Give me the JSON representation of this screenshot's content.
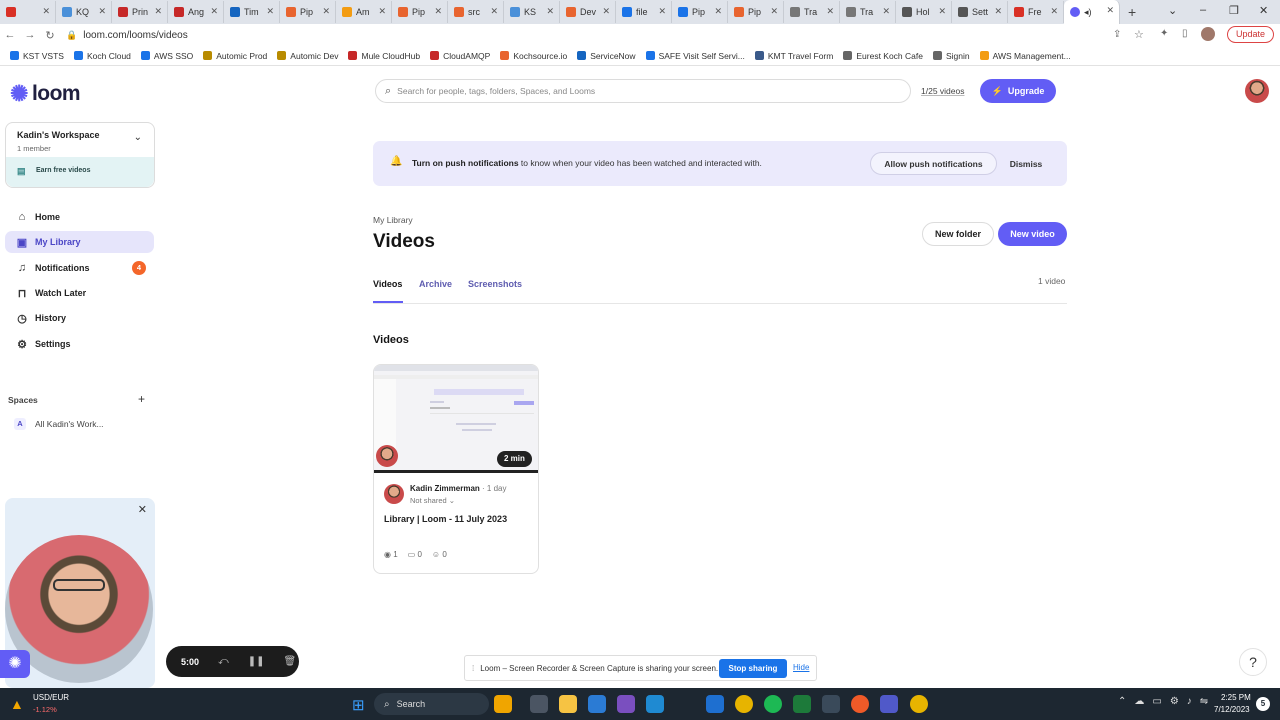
{
  "browser": {
    "tabs": [
      {
        "label": "",
        "color": "#d93025"
      },
      {
        "label": "KQ",
        "color": "#4a90d9"
      },
      {
        "label": "Prin",
        "color": "#c62828"
      },
      {
        "label": "Ang",
        "color": "#c62828"
      },
      {
        "label": "Tim",
        "color": "#1565c0"
      },
      {
        "label": "Pip",
        "color": "#e8642f"
      },
      {
        "label": "Am",
        "color": "#f39c12"
      },
      {
        "label": "Pip",
        "color": "#e8642f"
      },
      {
        "label": "src",
        "color": "#e8642f"
      },
      {
        "label": "KS",
        "color": "#4a90d9"
      },
      {
        "label": "Dev",
        "color": "#e8642f"
      },
      {
        "label": "file",
        "color": "#1a73e8"
      },
      {
        "label": "Pip",
        "color": "#1a73e8"
      },
      {
        "label": "Pip",
        "color": "#e8642f"
      },
      {
        "label": "Tra",
        "color": "#777777"
      },
      {
        "label": "Tra",
        "color": "#777777"
      },
      {
        "label": "Hol",
        "color": "#555555"
      },
      {
        "label": "Sett",
        "color": "#555555"
      },
      {
        "label": "Fre",
        "color": "#d93025"
      }
    ],
    "url": "loom.com/looms/videos",
    "update_label": "Update",
    "bookmarks": [
      {
        "label": "KST VSTS",
        "color": "#1a73e8"
      },
      {
        "label": "Koch Cloud",
        "color": "#1a73e8"
      },
      {
        "label": "AWS SSO",
        "color": "#1a73e8"
      },
      {
        "label": "Automic Prod",
        "color": "#b88b00"
      },
      {
        "label": "Automic Dev",
        "color": "#b88b00"
      },
      {
        "label": "Mule CloudHub",
        "color": "#c62828"
      },
      {
        "label": "CloudAMQP",
        "color": "#c62828"
      },
      {
        "label": "Kochsource.io",
        "color": "#e8642f"
      },
      {
        "label": "ServiceNow",
        "color": "#1565c0"
      },
      {
        "label": "SAFE Visit Self Servi...",
        "color": "#1a73e8"
      },
      {
        "label": "KMT Travel Form",
        "color": "#3a5a8a"
      },
      {
        "label": "Eurest Koch Cafe",
        "color": "#666666"
      },
      {
        "label": "Signin",
        "color": "#666666"
      },
      {
        "label": "AWS Management...",
        "color": "#f39c12"
      }
    ]
  },
  "sidebar": {
    "logo": "loom",
    "workspace": {
      "name": "Kadin's Workspace",
      "members": "1 member",
      "earn": "Earn free videos"
    },
    "nav": [
      {
        "label": "Home",
        "icon": "home-icon"
      },
      {
        "label": "My Library",
        "icon": "library-icon"
      },
      {
        "label": "Notifications",
        "icon": "bell-icon",
        "badge": "4"
      },
      {
        "label": "Watch Later",
        "icon": "bookmark-icon"
      },
      {
        "label": "History",
        "icon": "history-icon"
      },
      {
        "label": "Settings",
        "icon": "gear-icon"
      }
    ],
    "spaces_label": "Spaces",
    "spaces": [
      {
        "initial": "A",
        "label": "All Kadin's Work..."
      }
    ]
  },
  "recorder": {
    "time": "5:00"
  },
  "header": {
    "search_placeholder": "Search for people, tags, folders, Spaces, and Looms",
    "video_quota": "1/25 videos",
    "upgrade": "Upgrade"
  },
  "push_banner": {
    "bold": "Turn on push notifications",
    "text": " to know when your video has been watched and interacted with.",
    "allow": "Allow push notifications",
    "dismiss": "Dismiss"
  },
  "library": {
    "breadcrumb": "My Library",
    "title": "Videos",
    "new_folder": "New folder",
    "new_video": "New video",
    "tabs": [
      "Videos",
      "Archive",
      "Screenshots"
    ],
    "count": "1 video",
    "section": "Videos"
  },
  "video": {
    "duration": "2 min",
    "author": "Kadin Zimmerman",
    "age": "· 1 day",
    "sharing": "Not shared",
    "title": "Library | Loom - 11 July 2023",
    "views": "1",
    "comments": "0",
    "reactions": "0"
  },
  "share_bar": {
    "text": "Loom – Screen Recorder & Screen Capture is sharing your screen.",
    "stop": "Stop sharing",
    "hide": "Hide"
  },
  "taskbar": {
    "fx_pair": "USD/EUR",
    "fx_change": "-1.12%",
    "search": "Search",
    "time": "2:25 PM",
    "date": "7/12/2023",
    "notifications": "5"
  }
}
